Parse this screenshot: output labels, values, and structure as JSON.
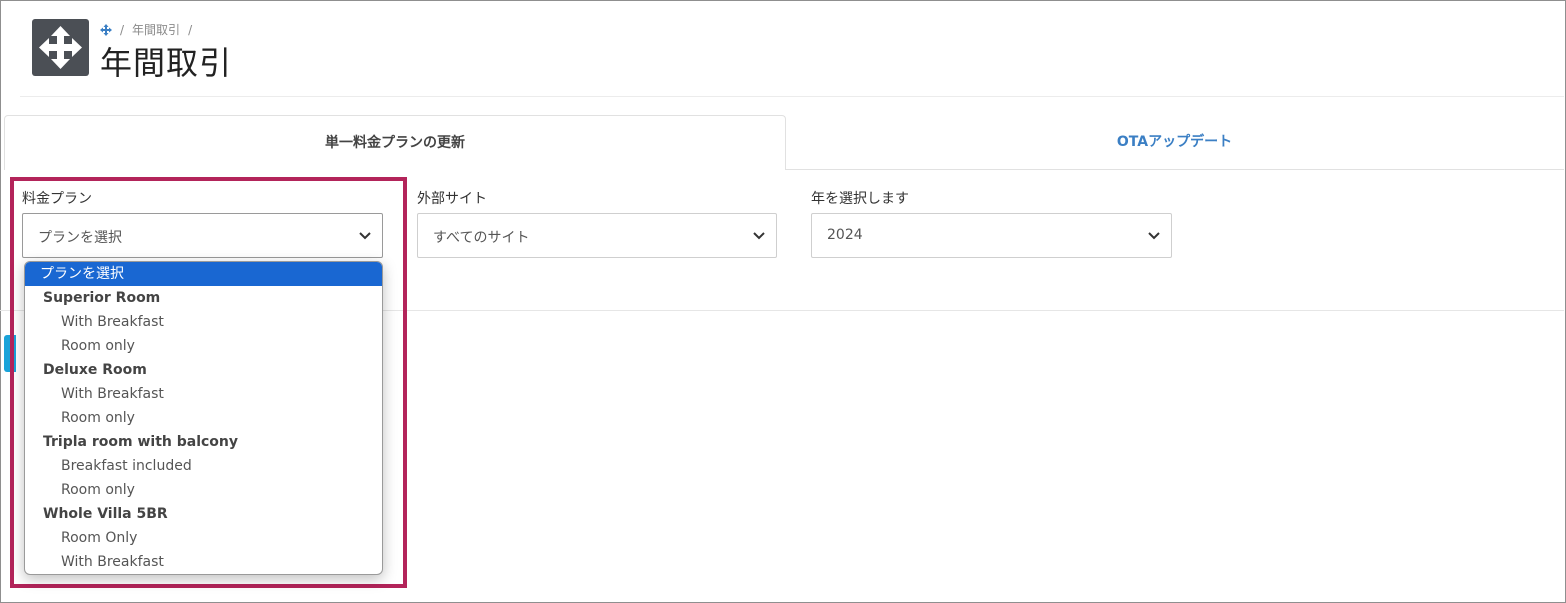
{
  "header": {
    "breadcrumb": "年間取引",
    "breadcrumb_sep": "/",
    "title": "年間取引"
  },
  "tabs": [
    {
      "label": "単一料金プランの更新",
      "active": true
    },
    {
      "label": "OTAアップデート",
      "active": false
    }
  ],
  "filters": {
    "plan": {
      "label": "料金プラン",
      "value": "プランを選択"
    },
    "site": {
      "label": "外部サイト",
      "value": "すべてのサイト"
    },
    "year": {
      "label": "年を選択します",
      "value": "2024"
    }
  },
  "dropdown": {
    "selected": "プランを選択",
    "groups": [
      {
        "name": "Superior Room",
        "options": [
          "With Breakfast",
          "Room only"
        ]
      },
      {
        "name": "Deluxe Room",
        "options": [
          "With Breakfast",
          "Room only"
        ]
      },
      {
        "name": "Tripla room with balcony",
        "options": [
          "Breakfast included",
          "Room only"
        ]
      },
      {
        "name": "Whole Villa 5BR",
        "options": [
          "Room Only",
          "With Breakfast"
        ]
      }
    ]
  },
  "colors": {
    "accent": "#1967d2",
    "tab_link": "#3b7fc4",
    "highlight": "#b3245a",
    "icon_bg": "#4b4f55"
  },
  "icons": [
    "move-arrows-icon",
    "chevron-down-icon"
  ]
}
